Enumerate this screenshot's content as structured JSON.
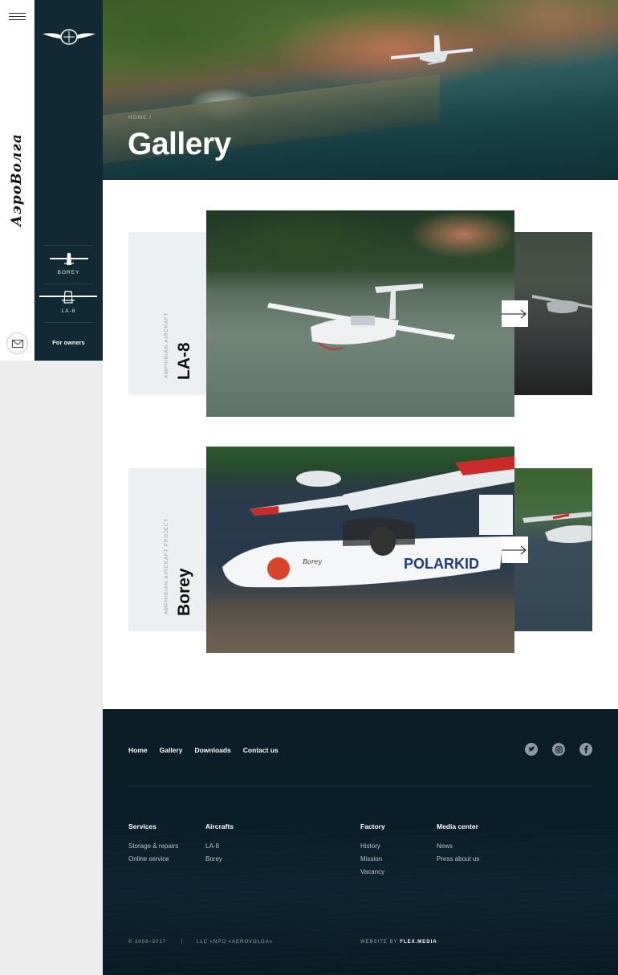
{
  "brand": {
    "logo_text": "АэроВолга"
  },
  "panel": {
    "items": [
      {
        "label": "BOREY"
      },
      {
        "label": "LA-8"
      }
    ],
    "owners_label": "For owners"
  },
  "hero": {
    "breadcrumb": "HOME  /",
    "title": "Gallery"
  },
  "cards": [
    {
      "subtitle": "AMPHIBIAN AIRCRAFT",
      "name": "LA-8"
    },
    {
      "subtitle": "AMPHIBIAN AIRCRAFT PROJECT",
      "name": "Borey"
    }
  ],
  "footer": {
    "nav": [
      "Home",
      "Gallery",
      "Downloads",
      "Contact us"
    ],
    "social": [
      "twitter-icon",
      "instagram-icon",
      "facebook-icon"
    ],
    "columns": [
      {
        "heading": "Services",
        "links": [
          "Storage & repairs",
          "Online service"
        ]
      },
      {
        "heading": "Aircrafts",
        "links": [
          "LA-8",
          "Borey"
        ]
      },
      {
        "heading": "Factory",
        "links": [
          "History",
          "Mission",
          "Vacancy"
        ]
      },
      {
        "heading": "Media center",
        "links": [
          "News",
          "Press about us"
        ]
      }
    ],
    "copyright": "© 2008–2017",
    "separator": "|",
    "company": "LLC «NPO «AEROVOLGA»",
    "credit_prefix": "WEBSITE BY",
    "credit_name": "FLEX.MEDIA"
  },
  "colors": {
    "panel": "#0f2935",
    "footer": "#0b1e28",
    "tag_bg": "#edf0f3"
  }
}
